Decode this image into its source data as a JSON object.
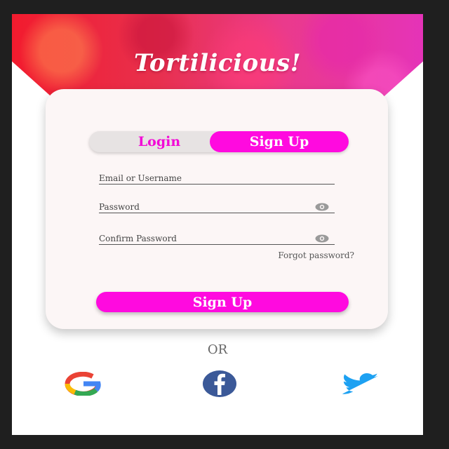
{
  "app": {
    "title": "Tortilicious!"
  },
  "tabs": {
    "login": "Login",
    "signup": "Sign Up",
    "active": "signup"
  },
  "form": {
    "email_placeholder": "Email or Username",
    "password_placeholder": "Password",
    "confirm_placeholder": "Confirm Password",
    "forgot_label": "Forgot password?",
    "submit_label": "Sign Up"
  },
  "divider": {
    "label": "OR"
  },
  "social": {
    "google_icon": "google-icon",
    "facebook_icon": "facebook-icon",
    "twitter_icon": "twitter-icon"
  },
  "colors": {
    "accent": "#ff0adf",
    "header_start": "#f21b2e",
    "header_end": "#e533b8",
    "facebook": "#3b5998",
    "twitter": "#1da1f2"
  }
}
